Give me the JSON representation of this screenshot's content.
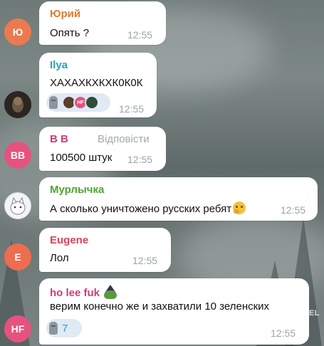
{
  "messages": [
    {
      "author": "Юрий",
      "author_color": "#e07b2c",
      "avatar_text": "Ю",
      "avatar_color": "#ea7a4f",
      "text": "Опять ?",
      "time": "12:55"
    },
    {
      "author": "Ilya",
      "author_color": "#2e9fb4",
      "avatar_text": "",
      "avatar_color": "#2a2622",
      "text": "ХАХАХКХКХК0К0К",
      "time": "12:55",
      "reaction": {
        "icon": "moai-icon",
        "avatars": [
          "HF"
        ]
      }
    },
    {
      "author": "B B",
      "author_color": "#d03a7a",
      "avatar_text": "BB",
      "avatar_color": "#e6527e",
      "reply_tag": "Відповісти",
      "text": "100500 штук",
      "time": "12:55"
    },
    {
      "author": "Мурлычка",
      "author_color": "#4da631",
      "avatar_text": "",
      "avatar_color": "#f4f4f6",
      "text": "А сколько уничтожено русских ребят",
      "time": "12:55"
    },
    {
      "author": "Eugene",
      "author_color": "#d8435a",
      "avatar_text": "E",
      "avatar_color": "#ee6c50",
      "text": "Лол",
      "time": "12:55"
    },
    {
      "author": "ho lee fuk",
      "author_color": "#d13b74",
      "avatar_text": "HF",
      "avatar_color": "#e6527e",
      "text": "верим конечно же и захватили 10 зеленских",
      "time": "12:55",
      "reaction": {
        "icon": "moai-icon",
        "count": "7"
      }
    }
  ],
  "watermark": "OBOZREVATEL"
}
